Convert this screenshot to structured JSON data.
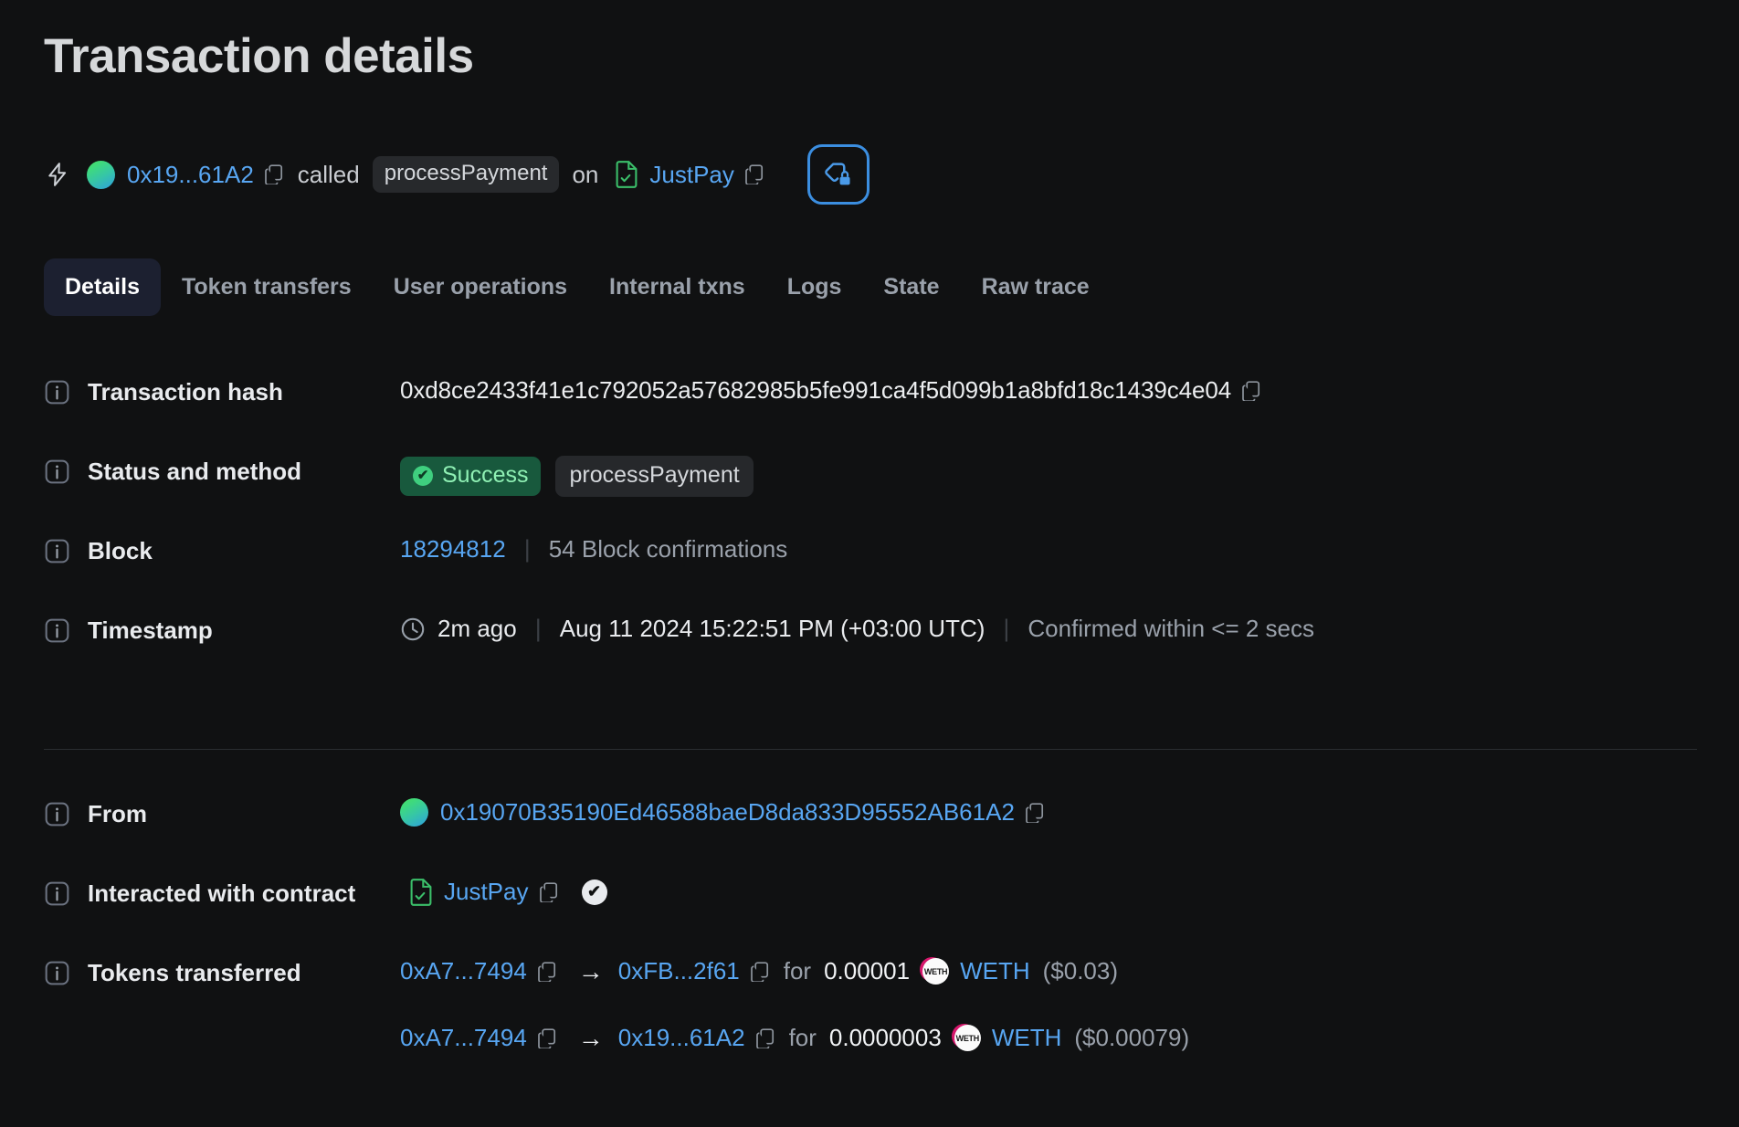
{
  "page_title": "Transaction details",
  "summary": {
    "bolt_icon": "lightning-bolt-icon",
    "from_short": "0x19...61A2",
    "called_word": "called",
    "method": "processPayment",
    "on_word": "on",
    "contract_name": "JustPay",
    "privacy_button_icon": "tag-lock-icon"
  },
  "tabs": [
    {
      "label": "Details",
      "active": true
    },
    {
      "label": "Token transfers",
      "active": false
    },
    {
      "label": "User operations",
      "active": false
    },
    {
      "label": "Internal txns",
      "active": false
    },
    {
      "label": "Logs",
      "active": false
    },
    {
      "label": "State",
      "active": false
    },
    {
      "label": "Raw trace",
      "active": false
    }
  ],
  "details": {
    "transaction_hash": {
      "label": "Transaction hash",
      "value": "0xd8ce2433f41e1c792052a57682985b5fe991ca4f5d099b1a8bfd18c1439c4e04"
    },
    "status_and_method": {
      "label": "Status and method",
      "status": "Success",
      "method": "processPayment"
    },
    "block": {
      "label": "Block",
      "number": "18294812",
      "confirmations": "54 Block confirmations"
    },
    "timestamp": {
      "label": "Timestamp",
      "relative": "2m ago",
      "absolute": "Aug 11 2024 15:22:51 PM (+03:00 UTC)",
      "confirmed": "Confirmed within <= 2 secs"
    },
    "from": {
      "label": "From",
      "address": "0x19070B35190Ed46588baeD8da833D95552AB61A2"
    },
    "interacted_with_contract": {
      "label": "Interacted with contract",
      "contract_name": "JustPay"
    },
    "tokens_transferred": {
      "label": "Tokens transferred",
      "transfers": [
        {
          "from": "0xA7...7494",
          "to": "0xFB...2f61",
          "for_word": "for",
          "amount": "0.00001",
          "token": "WETH",
          "token_symbol": "WETH",
          "usd": "($0.03)"
        },
        {
          "from": "0xA7...7494",
          "to": "0x19...61A2",
          "for_word": "for",
          "amount": "0.0000003",
          "token": "WETH",
          "token_symbol": "WETH",
          "usd": "($0.00079)"
        }
      ]
    }
  },
  "colors": {
    "background": "#101112",
    "link": "#58a6f2",
    "success_bg": "#18593d",
    "success_text": "#8ff0b4",
    "muted": "#9aa1ab",
    "accent_border": "#3b8ee0"
  },
  "glyphs": {
    "arrow": "→",
    "pipe": "|",
    "check": "✔",
    "info": "i"
  }
}
